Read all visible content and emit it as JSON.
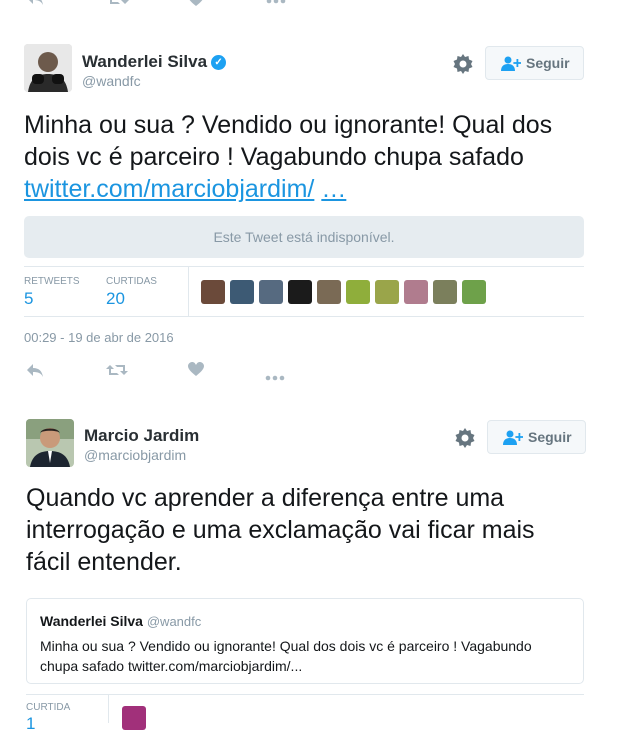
{
  "icons": {
    "reply": "reply-icon",
    "retweet": "retweet-icon",
    "like": "heart-icon",
    "more": "more-icon"
  },
  "tweet1": {
    "author_name": "Wanderlei Silva",
    "author_handle": "@wandfc",
    "verified": true,
    "follow_label": "Seguir",
    "text": "Minha ou sua ? Vendido ou ignorante! Qual dos dois vc é parceiro ! Vagabundo chupa safado",
    "link_text": "twitter.com/marciobjardim/",
    "link_ellipsis": "…",
    "unavailable_text": "Este Tweet está indisponível.",
    "stats": {
      "retweets_label": "RETWEETS",
      "retweets_value": "5",
      "likes_label": "CURTIDAS",
      "likes_value": "20"
    },
    "liker_avatar_colors": [
      "#6b4a3a",
      "#3d5a74",
      "#566a80",
      "#1b1b1b",
      "#7a6a55",
      "#8fae3b",
      "#9aa54a",
      "#b07c8e",
      "#7b7f5c",
      "#6ea14a"
    ],
    "timestamp": "00:29 - 19 de abr de 2016"
  },
  "tweet2": {
    "author_name": "Marcio Jardim",
    "author_handle": "@marciobjardim",
    "follow_label": "Seguir",
    "text": "Quando vc aprender a diferença entre uma interrogação e uma exclamação vai ficar mais fácil entender.",
    "quote": {
      "author_name": "Wanderlei Silva",
      "author_handle": "@wandfc",
      "text": "Minha ou sua ? Vendido ou ignorante! Qual dos dois vc é parceiro ! Vagabundo chupa safado twitter.com/marciobjardim/..."
    },
    "stats": {
      "likes_label": "CURTIDA",
      "likes_value": "1"
    },
    "colors": {
      "accent": "#1b95e0"
    }
  }
}
